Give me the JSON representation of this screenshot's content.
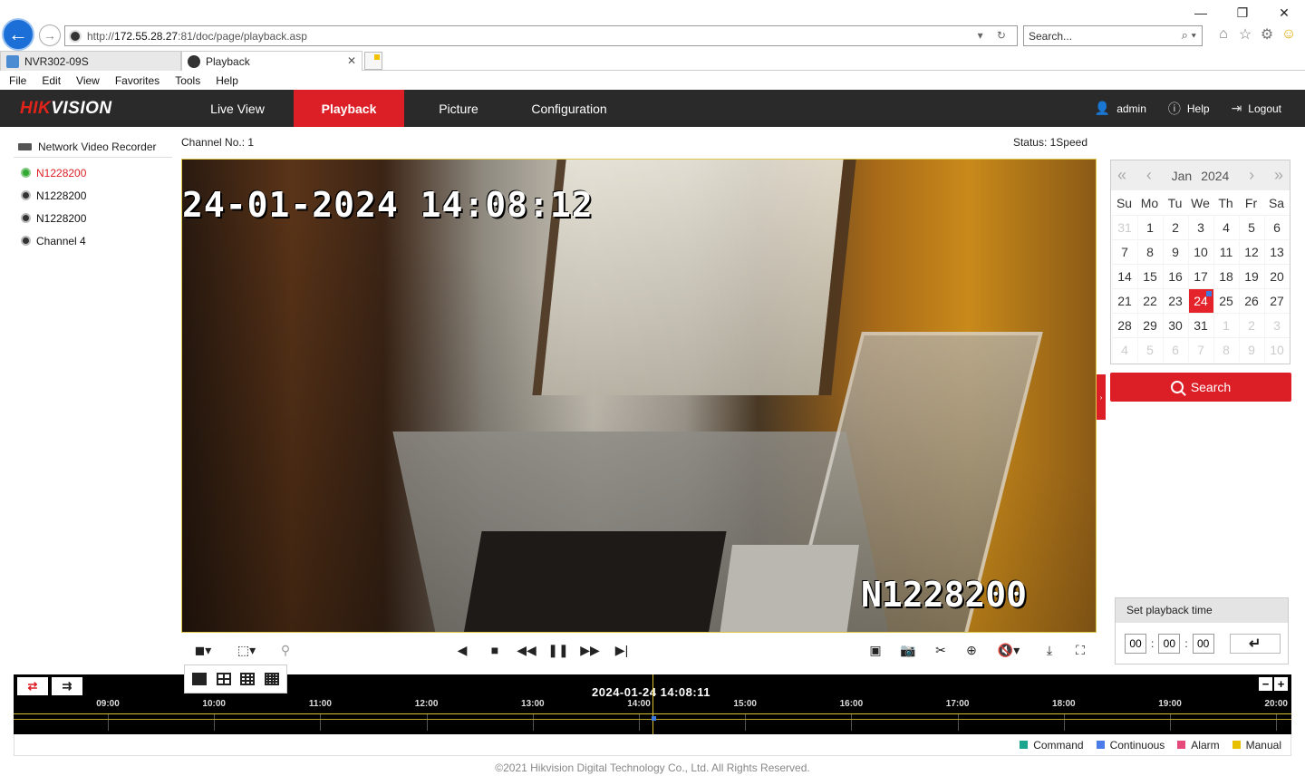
{
  "browser": {
    "url_prefix": "http://",
    "url_host": "172.55.28.27",
    "url_rest": ":81/doc/page/playback.asp",
    "search_placeholder": "Search...",
    "tabs": [
      {
        "label": "NVR302-09S"
      },
      {
        "label": "Playback"
      }
    ],
    "menu": [
      "File",
      "Edit",
      "View",
      "Favorites",
      "Tools",
      "Help"
    ]
  },
  "nav": {
    "logo_red": "HIK",
    "logo_white": "VISION",
    "items": [
      "Live View",
      "Playback",
      "Picture",
      "Configuration"
    ],
    "active": "Playback",
    "user": "admin",
    "help": "Help",
    "logout": "Logout"
  },
  "tree": {
    "root": "Network Video Recorder",
    "channels": [
      "N1228200",
      "N1228200",
      "N1228200",
      "Channel 4"
    ]
  },
  "channel_label": "Channel No.: 1",
  "status_label": "Status: 1Speed",
  "video": {
    "osd_time": "24-01-2024 14:08:12",
    "osd_camera": "N1228200"
  },
  "calendar": {
    "month": "Jan",
    "year": "2024",
    "weekdays": [
      "Su",
      "Mo",
      "Tu",
      "We",
      "Th",
      "Fr",
      "Sa"
    ],
    "days": [
      "31",
      "1",
      "2",
      "3",
      "4",
      "5",
      "6",
      "7",
      "8",
      "9",
      "10",
      "11",
      "12",
      "13",
      "14",
      "15",
      "16",
      "17",
      "18",
      "19",
      "20",
      "21",
      "22",
      "23",
      "24",
      "25",
      "26",
      "27",
      "28",
      "29",
      "30",
      "31",
      "1",
      "2",
      "3",
      "4",
      "5",
      "6",
      "7",
      "8",
      "9",
      "10"
    ],
    "selected_day": "24"
  },
  "search_button": "Search",
  "playback_time": {
    "title": "Set playback time",
    "hh": "00",
    "mm": "00",
    "ss": "00"
  },
  "timeline": {
    "current": "2024-01-24 14:08:11",
    "hours": [
      "09:00",
      "10:00",
      "11:00",
      "12:00",
      "13:00",
      "14:00",
      "15:00",
      "16:00",
      "17:00",
      "18:00",
      "19:00",
      "20:00"
    ]
  },
  "legend": [
    {
      "label": "Command",
      "color": "#1aa58e"
    },
    {
      "label": "Continuous",
      "color": "#4a7be8"
    },
    {
      "label": "Alarm",
      "color": "#e64a7b"
    },
    {
      "label": "Manual",
      "color": "#e8c000"
    }
  ],
  "colors": {
    "accent": "#dc1f26",
    "nav_bg": "#2a2a2a"
  },
  "footer": "©2021 Hikvision Digital Technology Co., Ltd. All Rights Reserved."
}
